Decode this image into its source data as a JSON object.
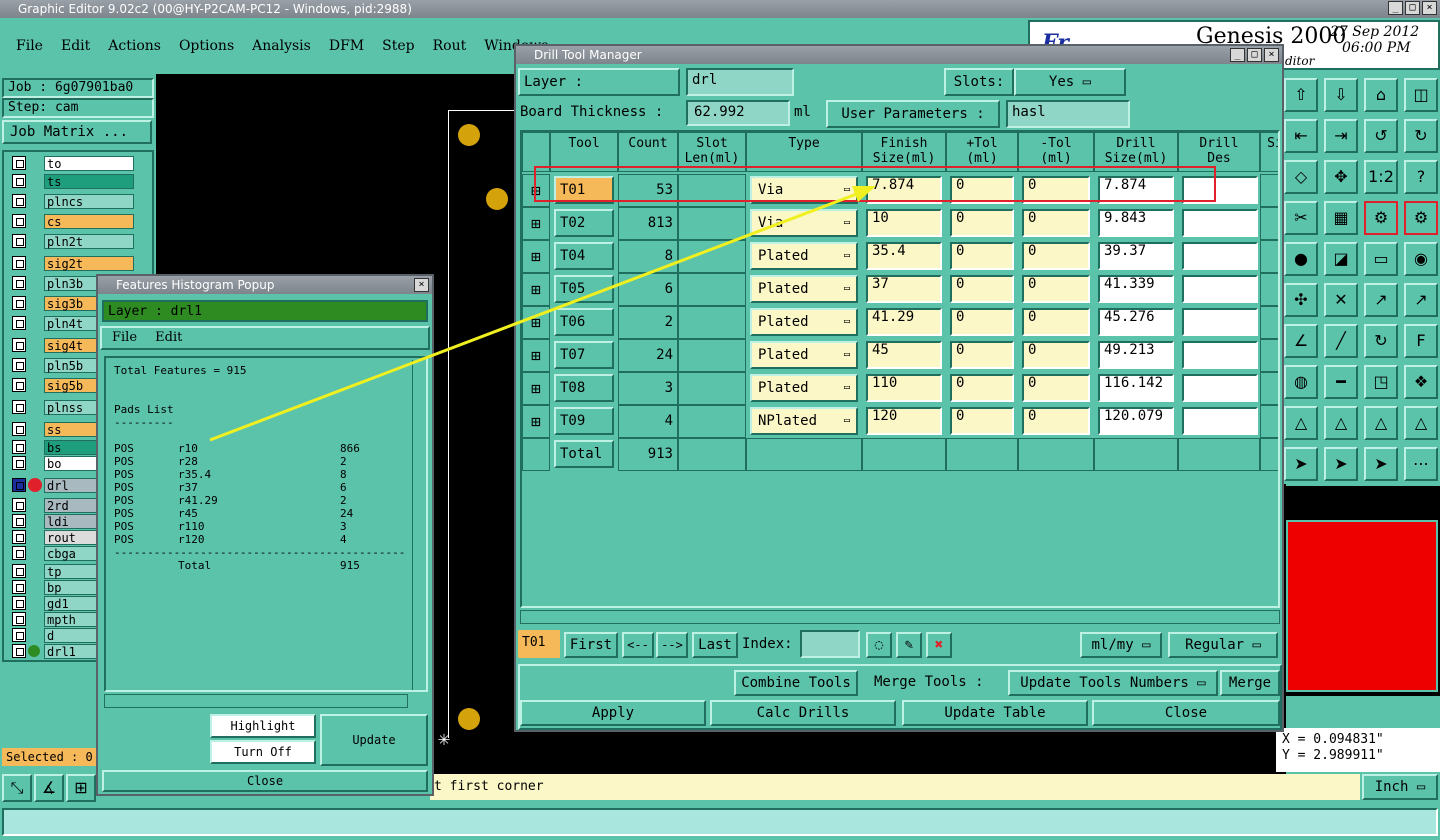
{
  "app": {
    "title": "Graphic Editor 9.02c2 (00@HY-P2CAM-PC12 - Windows, pid:2988)",
    "brand": "Genesis 2000",
    "brand_sub": "ditor",
    "date": "27 Sep 2012",
    "time": "06:00 PM"
  },
  "menu": [
    "File",
    "Edit",
    "Actions",
    "Options",
    "Analysis",
    "DFM",
    "Step",
    "Rout",
    "Windows"
  ],
  "job": {
    "job": "Job : 6g07901ba0",
    "step": "Step: cam",
    "matrix_btn": "Job Matrix ..."
  },
  "layers": [
    {
      "name": "to",
      "color": "#ffffff"
    },
    {
      "name": "ts",
      "color": "#1f9e7e"
    },
    {
      "name": "plncs",
      "color": "#8fd6c6"
    },
    {
      "name": "cs",
      "color": "#f5b95a"
    },
    {
      "name": "pln2t",
      "color": "#8fd6c6"
    },
    {
      "name": "sig2t",
      "color": "#f5b95a"
    },
    {
      "name": "pln3b",
      "color": "#8fd6c6"
    },
    {
      "name": "sig3b",
      "color": "#f5b95a"
    },
    {
      "name": "pln4t",
      "color": "#8fd6c6"
    },
    {
      "name": "sig4t",
      "color": "#f5b95a"
    },
    {
      "name": "pln5b",
      "color": "#8fd6c6"
    },
    {
      "name": "sig5b",
      "color": "#f5b95a"
    },
    {
      "name": "plnss",
      "color": "#8fd6c6"
    },
    {
      "name": "ss",
      "color": "#f5b95a"
    },
    {
      "name": "bs",
      "color": "#1f9e7e"
    },
    {
      "name": "bo",
      "color": "#ffffff"
    },
    {
      "name": "drl",
      "color": "#a9b9c0"
    },
    {
      "name": "2rd",
      "color": "#a9b9c0"
    },
    {
      "name": "ldi",
      "color": "#a9b9c0"
    },
    {
      "name": "rout",
      "color": "#dcdcdc"
    },
    {
      "name": "cbga",
      "color": "#8fd6c6"
    },
    {
      "name": "tp",
      "color": "#8fd6c6"
    },
    {
      "name": "bp",
      "color": "#8fd6c6"
    },
    {
      "name": "gd1",
      "color": "#8fd6c6"
    },
    {
      "name": "mpth",
      "color": "#8fd6c6"
    },
    {
      "name": "d",
      "color": "#8fd6c6"
    },
    {
      "name": "drl1",
      "color": "#8fd6c6"
    }
  ],
  "selected": "Selected : 0",
  "status_msg": "t first corner",
  "coords": {
    "x": "X = 0.094831\"",
    "y": "Y = 2.989911\""
  },
  "units_btn": "Inch",
  "histogram": {
    "title": "Features Histogram Popup",
    "layer": "Layer :  drl1",
    "menu": [
      "File",
      "Edit"
    ],
    "total_features": "Total Features = 915",
    "pads_title": "Pads List",
    "pads_rule": "---------",
    "pads": [
      {
        "pol": "POS",
        "sym": "r10",
        "count": "866"
      },
      {
        "pol": "POS",
        "sym": "r28",
        "count": "2"
      },
      {
        "pol": "POS",
        "sym": "r35.4",
        "count": "8"
      },
      {
        "pol": "POS",
        "sym": "r37",
        "count": "6"
      },
      {
        "pol": "POS",
        "sym": "r41.29",
        "count": "2"
      },
      {
        "pol": "POS",
        "sym": "r45",
        "count": "24"
      },
      {
        "pol": "POS",
        "sym": "r110",
        "count": "3"
      },
      {
        "pol": "POS",
        "sym": "r120",
        "count": "4"
      }
    ],
    "total_rule": "--------------------------------------------",
    "total_label": "Total",
    "total_value": "915",
    "highlight_btn": "Highlight",
    "turnoff_btn": "Turn Off",
    "update_btn": "Update",
    "close_btn": "Close"
  },
  "dtm": {
    "title": "Drill Tool Manager",
    "layer_label": "Layer          :",
    "layer_value": "drl",
    "slots_label": "Slots:",
    "slots_value": "Yes",
    "thickness_label": "Board Thickness :",
    "thickness_value": "62.992",
    "thickness_unit": "ml",
    "user_params_label": "User Parameters :",
    "user_params_value": "hasl",
    "headers": [
      "Tool",
      "Count",
      "Slot\nLen(ml)",
      "Type",
      "Finish\nSize(ml)",
      "+Tol\n(ml)",
      "-Tol\n(ml)",
      "Drill\nSize(ml)",
      "Drill\nDes",
      "Si"
    ],
    "rows": [
      {
        "tool": "T01",
        "count": "53",
        "type": "Via",
        "finish": "7.874",
        "ptol": "0",
        "ntol": "0",
        "drill": "7.874"
      },
      {
        "tool": "T02",
        "count": "813",
        "type": "Via",
        "finish": "10",
        "ptol": "0",
        "ntol": "0",
        "drill": "9.843"
      },
      {
        "tool": "T04",
        "count": "8",
        "type": "Plated",
        "finish": "35.4",
        "ptol": "0",
        "ntol": "0",
        "drill": "39.37"
      },
      {
        "tool": "T05",
        "count": "6",
        "type": "Plated",
        "finish": "37",
        "ptol": "0",
        "ntol": "0",
        "drill": "41.339"
      },
      {
        "tool": "T06",
        "count": "2",
        "type": "Plated",
        "finish": "41.29",
        "ptol": "0",
        "ntol": "0",
        "drill": "45.276"
      },
      {
        "tool": "T07",
        "count": "24",
        "type": "Plated",
        "finish": "45",
        "ptol": "0",
        "ntol": "0",
        "drill": "49.213"
      },
      {
        "tool": "T08",
        "count": "3",
        "type": "Plated",
        "finish": "110",
        "ptol": "0",
        "ntol": "0",
        "drill": "116.142"
      },
      {
        "tool": "T09",
        "count": "4",
        "type": "NPlated",
        "finish": "120",
        "ptol": "0",
        "ntol": "0",
        "drill": "120.079"
      }
    ],
    "total_label": "Total",
    "total_count": "913",
    "nav": {
      "current": "T01",
      "first": "First",
      "prev": "<--",
      "next": "-->",
      "last": "Last",
      "index_label": "Index:",
      "units": "ml/my",
      "mode": "Regular"
    },
    "combine_btn": "Combine Tools",
    "merge_label": "Merge Tools :",
    "update_numbers": "Update Tools Numbers",
    "merge_btn": "Merge",
    "apply_btn": "Apply",
    "calc_btn": "Calc Drills",
    "update_table_btn": "Update Table",
    "close_btn": "Close"
  },
  "colors": {
    "panel": "#5cc3ab",
    "highlight_red": "#e0202a",
    "arrow": "#f0f020",
    "canvas": "#000000"
  }
}
